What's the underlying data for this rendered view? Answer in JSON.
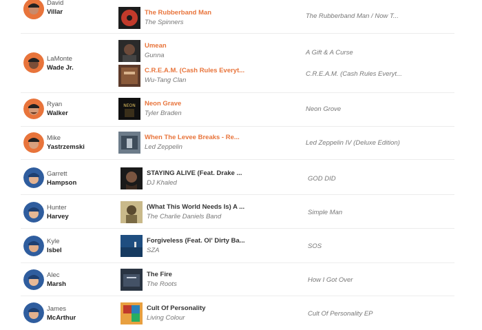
{
  "colors": {
    "accent": "#e8743b",
    "orange_team": "#e8743b",
    "blue_team": "#2f5d9e"
  },
  "players": [
    {
      "first": "David",
      "last": "Villar",
      "team": "orange",
      "songs": [
        {
          "title": "The Rubberband Man",
          "artist": "The Spinners",
          "album": "The Rubberband Man / Now T...",
          "highlight": true
        }
      ]
    },
    {
      "first": "LaMonte",
      "last": "Wade Jr.",
      "team": "orange",
      "songs": [
        {
          "title": "Umean",
          "artist": "Gunna",
          "album": "A Gift & A Curse",
          "highlight": true
        },
        {
          "title": "C.R.E.A.M. (Cash Rules Everyt...",
          "artist": "Wu-Tang Clan",
          "album": "C.R.E.A.M. (Cash Rules Everyt...",
          "highlight": true
        }
      ]
    },
    {
      "first": "Ryan",
      "last": "Walker",
      "team": "orange",
      "songs": [
        {
          "title": "Neon Grave",
          "artist": "Tyler Braden",
          "album": "Neon Grove",
          "highlight": true
        }
      ]
    },
    {
      "first": "Mike",
      "last": "Yastrzemski",
      "team": "orange",
      "songs": [
        {
          "title": "When The Levee Breaks - Re...",
          "artist": "Led Zeppelin",
          "album": "Led Zeppelin IV (Deluxe Edition)",
          "highlight": true
        }
      ]
    },
    {
      "first": "Garrett",
      "last": "Hampson",
      "team": "blue",
      "songs": [
        {
          "title": "STAYING ALIVE (Feat. Drake ...",
          "artist": "DJ Khaled",
          "album": "GOD DID",
          "highlight": false
        }
      ]
    },
    {
      "first": "Hunter",
      "last": "Harvey",
      "team": "blue",
      "songs": [
        {
          "title": "(What This World Needs Is) A ...",
          "artist": "The Charlie Daniels Band",
          "album": "Simple Man",
          "highlight": false
        }
      ]
    },
    {
      "first": "Kyle",
      "last": "Isbel",
      "team": "blue",
      "songs": [
        {
          "title": "Forgiveless (Feat. Ol' Dirty Ba...",
          "artist": "SZA",
          "album": "SOS",
          "highlight": false
        }
      ]
    },
    {
      "first": "Alec",
      "last": "Marsh",
      "team": "blue",
      "songs": [
        {
          "title": "The Fire",
          "artist": "The Roots",
          "album": "How I Got Over",
          "highlight": false
        }
      ]
    },
    {
      "first": "James",
      "last": "McArthur",
      "team": "blue",
      "songs": [
        {
          "title": "Cult Of Personality",
          "artist": "Living Colour",
          "album": "Cult Of Personality EP",
          "highlight": false
        }
      ]
    }
  ]
}
